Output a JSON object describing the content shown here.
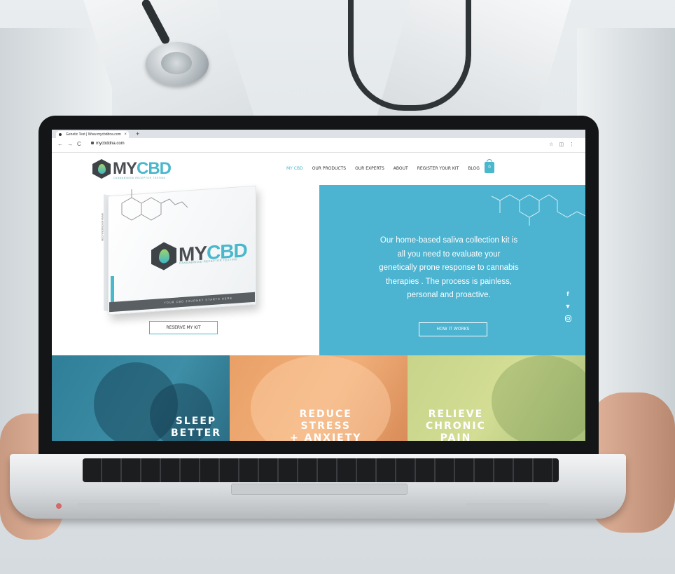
{
  "browser": {
    "tab_title": "Genetic Test | Www.mycbddna.com",
    "tab_close": "×",
    "new_tab": "+",
    "url": "mycbddna.com"
  },
  "site": {
    "logo_my": "MY",
    "logo_cbd": "CBD",
    "logo_subtitle": "CANNABINOID RECEPTOR TESTING",
    "nav": [
      {
        "label": "MY CBD",
        "active": true
      },
      {
        "label": "OUR PRODUCTS"
      },
      {
        "label": "OUR EXPERTS"
      },
      {
        "label": "ABOUT"
      },
      {
        "label": "REGISTER YOUR KIT"
      },
      {
        "label": "BLOG"
      }
    ],
    "cart_count": "0"
  },
  "hero": {
    "box_logo_my": "MY",
    "box_logo_cbd": "CBD",
    "box_subtitle": "CANNABINOID RECEPTOR TESTING",
    "box_tagline": "YOUR CBD JOURNEY STARTS HERE",
    "box_side_text": "WWW.MYCBDDNA.COM",
    "reserve_button": "RESERVE MY KIT",
    "copy": "Our home-based saliva collection kit is all you need to evaluate your genetically prone response to cannabis therapies .  The process is painless, personal and proactive.",
    "how_button": "HOW IT WORKS"
  },
  "social": {
    "facebook": "f",
    "twitter": "🐦"
  },
  "tiles": [
    {
      "label_lines": [
        "SLEEP",
        "BETTER"
      ]
    },
    {
      "label_lines": [
        "REDUCE",
        "STRESS",
        "+ ANXIETY"
      ]
    },
    {
      "label_lines": [
        "RELIEVE",
        "CHRONIC",
        "PAIN"
      ]
    }
  ],
  "colors": {
    "accent": "#49b8cc",
    "hero_blue": "#4cb3d0",
    "tile_sleep": "#2f7f98",
    "tile_stress": "#e9a067",
    "tile_pain": "#c7d48a"
  }
}
